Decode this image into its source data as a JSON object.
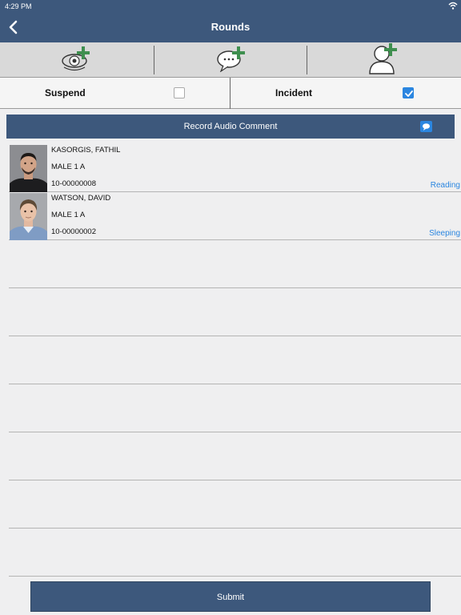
{
  "status_bar": {
    "time": "4:29 PM",
    "wifi_icon": "wifi-icon"
  },
  "nav": {
    "title": "Rounds",
    "back_icon": "chevron-left-icon"
  },
  "toolbar": {
    "tools": [
      {
        "icon": "add-observation-icon"
      },
      {
        "icon": "add-comment-icon"
      },
      {
        "icon": "add-person-icon"
      }
    ]
  },
  "toggles": {
    "suspend": {
      "label": "Suspend",
      "checked": false
    },
    "incident": {
      "label": "Incident",
      "checked": true
    }
  },
  "audio": {
    "label": "Record Audio Comment",
    "icon": "comment-icon"
  },
  "inmates": [
    {
      "name": "KASORGIS, FATHIL",
      "location": "MALE 1 A",
      "id": "10-00000008",
      "status": "Reading"
    },
    {
      "name": "WATSON, DAVID",
      "location": "MALE 1 A",
      "id": "10-00000002",
      "status": "Sleeping"
    }
  ],
  "submit_label": "Submit",
  "colors": {
    "bar": "#3d587c",
    "accent": "#2b86e0",
    "plus": "#3f8f4f",
    "background": "#efeff0"
  }
}
